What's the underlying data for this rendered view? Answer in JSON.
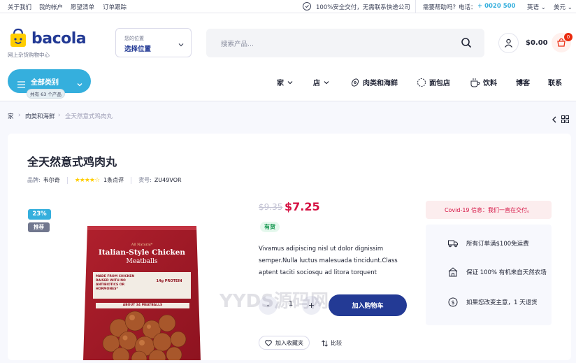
{
  "topbar": {
    "links": [
      "关于我们",
      "我的帐户",
      "愿望清单",
      "订单跟踪"
    ],
    "secure": "100%安全交付，无需联系快递公司",
    "help_prefix": "需要帮助吗？电话：",
    "phone": "+ 0020 500",
    "language": "英语",
    "currency": "美元"
  },
  "header": {
    "logo": "bacola",
    "tagline": "网上杂货购物中心",
    "location_label": "您的位置",
    "location_value": "选择位置",
    "search_placeholder": "搜索产品...",
    "cart_total": "$0.00",
    "cart_count": "0",
    "categories_label": "全部类别",
    "categories_sub": "共有 63 个产品",
    "nav": [
      "家",
      "店",
      "肉类和海鲜",
      "面包店",
      "饮料",
      "博客",
      "联系"
    ]
  },
  "breadcrumb": [
    "家",
    "肉类和海鲜",
    "全天然意式鸡肉丸"
  ],
  "product": {
    "title": "全天然意式鸡肉丸",
    "brand_label": "品牌:",
    "brand": "韦尔奇",
    "rating": 4,
    "reviews": "1条点评",
    "sku_label": "货号:",
    "sku": "ZU49VOR",
    "discount_badge": "23%",
    "recommend_badge": "推荐",
    "old_price": "$9.35",
    "price": "$7.25",
    "stock": "有货",
    "description": "Vivamus adipiscing nisl ut dolor dignissim semper.Nulla luctus malesuada tincidunt.Class aptent taciti sociosqu ad litora torquent",
    "qty_minus": "-",
    "qty": "1",
    "qty_plus": "+",
    "add_to_cart": "加入购物车",
    "wishlist": "加入收藏夹",
    "compare": "比较",
    "package": {
      "brand_small": "All Natural*",
      "name_line1": "Italian-Style Chicken",
      "name_line2": "Meatballs",
      "subtitle": "MADE FROM CHICKEN RAISED WITH NO ANTIBIOTICS OR HORMONES*",
      "protein": "14g PROTEIN",
      "count": "ABOUT 34 MEATBALLS"
    }
  },
  "notice": "Covid-19 信息：我们一直在交付。",
  "features": [
    "所有订单满$100免运费",
    "保证 100% 有机来自天然农场",
    "如果您改变主意，1 天退货"
  ],
  "watermark": "YYDS源码网",
  "colors": {
    "brand": "#233a95",
    "accent": "#35afdd",
    "price": "#d51243",
    "stock_bg": "#e5f8ed",
    "stock_text": "#038e42",
    "notice_bg": "#fcedee"
  }
}
